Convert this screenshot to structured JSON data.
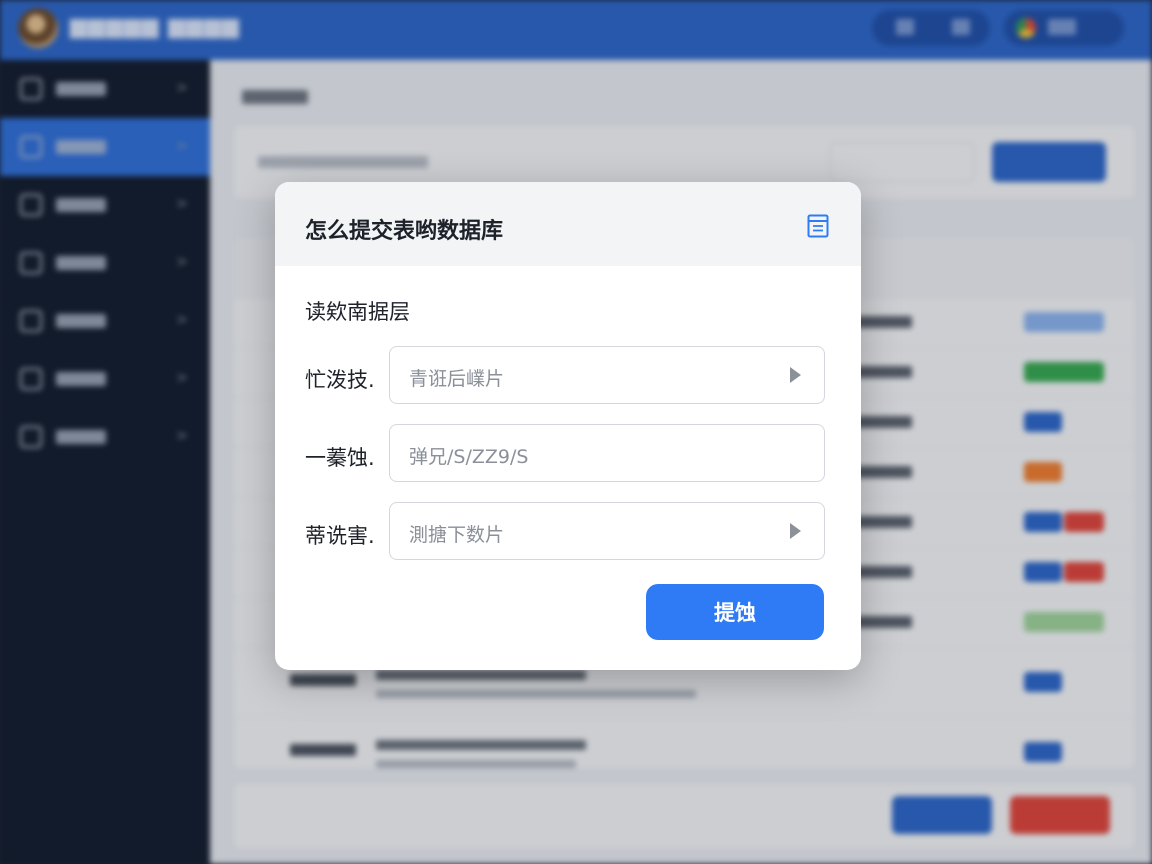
{
  "dialog": {
    "title": "怎么提交表哟数据库",
    "section_title": "读欸南据层",
    "fields": [
      {
        "label": "忙泼技.",
        "value": "青诳后嶫片"
      },
      {
        "label": "一蓁蚀.",
        "value": "弹兄/S/ZZ9/S"
      },
      {
        "label": "蒂诜害.",
        "value": "測搪下数片"
      }
    ],
    "submit_label": "提蚀"
  },
  "colors": {
    "topbar": "#2c66c9",
    "sidebar": "#121b2c",
    "primary_button": "#2f7bf5",
    "header_icon": "#2f7bf5"
  },
  "icons": {
    "header": "document-icon",
    "field_dropdown": "caret-right-icon"
  }
}
